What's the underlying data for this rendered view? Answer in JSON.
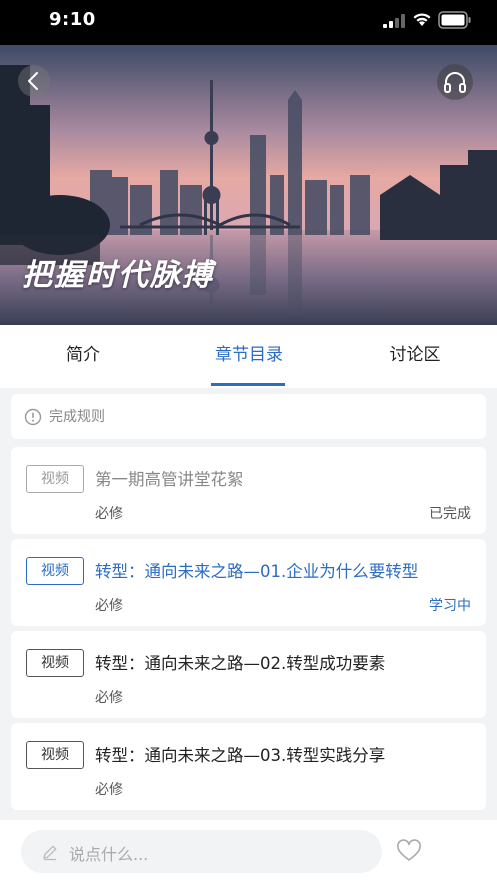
{
  "status_bar": {
    "time": "9:10"
  },
  "hero": {
    "caption": "把握时代脉搏"
  },
  "tabs": [
    {
      "label": "简介",
      "selected": false
    },
    {
      "label": "章节目录",
      "selected": true
    },
    {
      "label": "讨论区",
      "selected": false
    }
  ],
  "rule": {
    "text": "完成规则"
  },
  "chapters": [
    {
      "badge": "视频",
      "title": "第一期高管讲堂花絮",
      "required": "必修",
      "status": "已完成"
    },
    {
      "badge": "视频",
      "title": "转型：通向未来之路—01.企业为什么要转型",
      "required": "必修",
      "status": "学习中"
    },
    {
      "badge": "视频",
      "title": "转型：通向未来之路—02.转型成功要素",
      "required": "必修",
      "status": ""
    },
    {
      "badge": "视频",
      "title": "转型：通向未来之路—03.转型实践分享",
      "required": "必修",
      "status": ""
    }
  ],
  "comment": {
    "placeholder": "说点什么..."
  },
  "colors": {
    "accent": "#2b6cc4",
    "background": "#f2f3f5"
  }
}
